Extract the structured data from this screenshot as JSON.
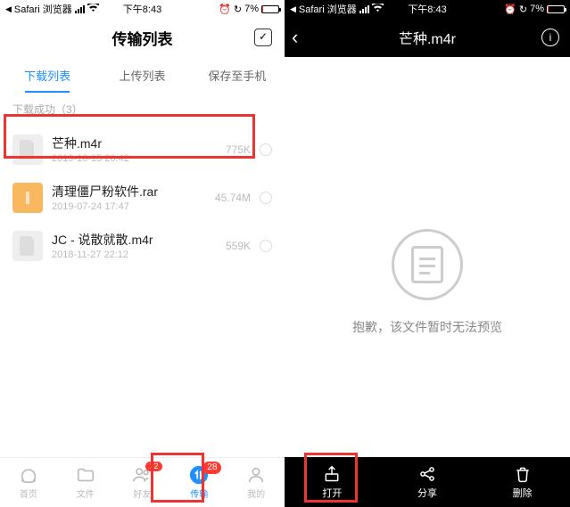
{
  "status": {
    "back_app": "Safari 浏览器",
    "time": "下午8:43",
    "battery_pct": "7%",
    "alarm": "⏰"
  },
  "phoneA": {
    "header_title": "传输列表",
    "tabs": [
      "下载列表",
      "上传列表",
      "保存至手机"
    ],
    "active_tab": 0,
    "section_header": "下载成功（3）",
    "files": [
      {
        "name": "芒种.m4r",
        "date": "2019-10-15 20:42",
        "size": "775K",
        "thumb": "file"
      },
      {
        "name": "清理僵尸粉软件.rar",
        "date": "2019-07-24 17:47",
        "size": "45.74M",
        "thumb": "archive"
      },
      {
        "name": "JC - 说散就散.m4r",
        "date": "2018-11-27 22:12",
        "size": "559K",
        "thumb": "file"
      }
    ],
    "bottom_nav": [
      {
        "label": "首页",
        "badge": null
      },
      {
        "label": "文件",
        "badge": null
      },
      {
        "label": "好友",
        "badge": "12"
      },
      {
        "label": "传输",
        "badge": "28"
      },
      {
        "label": "我的",
        "badge": null
      }
    ],
    "active_nav": 3
  },
  "phoneB": {
    "header_title": "芒种.m4r",
    "empty_message": "抱歉，该文件暂时无法预览",
    "bottom_nav": [
      {
        "label": "打开"
      },
      {
        "label": "分享"
      },
      {
        "label": "删除"
      }
    ]
  }
}
